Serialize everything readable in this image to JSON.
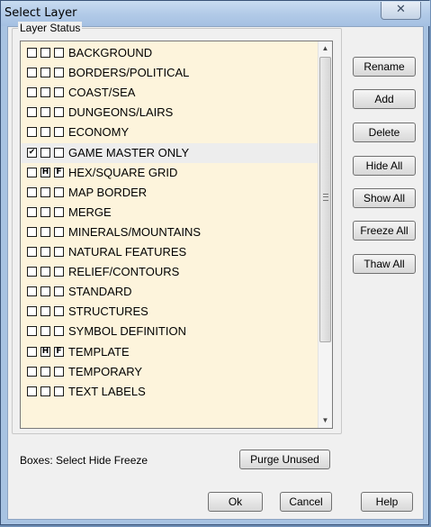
{
  "window": {
    "title": "Select Layer",
    "close_glyph": "✕"
  },
  "group": {
    "legend": "Layer Status"
  },
  "layers": [
    {
      "name": "BACKGROUND",
      "select": false,
      "hide": false,
      "freeze": false
    },
    {
      "name": "BORDERS/POLITICAL",
      "select": false,
      "hide": false,
      "freeze": false
    },
    {
      "name": "COAST/SEA",
      "select": false,
      "hide": false,
      "freeze": false
    },
    {
      "name": "DUNGEONS/LAIRS",
      "select": false,
      "hide": false,
      "freeze": false
    },
    {
      "name": "ECONOMY",
      "select": false,
      "hide": false,
      "freeze": false
    },
    {
      "name": "GAME MASTER ONLY",
      "select": true,
      "hide": false,
      "freeze": false,
      "highlighted": true
    },
    {
      "name": "HEX/SQUARE GRID",
      "select": false,
      "hide": true,
      "freeze": true
    },
    {
      "name": "MAP BORDER",
      "select": false,
      "hide": false,
      "freeze": false
    },
    {
      "name": "MERGE",
      "select": false,
      "hide": false,
      "freeze": false
    },
    {
      "name": "MINERALS/MOUNTAINS",
      "select": false,
      "hide": false,
      "freeze": false
    },
    {
      "name": "NATURAL FEATURES",
      "select": false,
      "hide": false,
      "freeze": false
    },
    {
      "name": "RELIEF/CONTOURS",
      "select": false,
      "hide": false,
      "freeze": false
    },
    {
      "name": "STANDARD",
      "select": false,
      "hide": false,
      "freeze": false
    },
    {
      "name": "STRUCTURES",
      "select": false,
      "hide": false,
      "freeze": false
    },
    {
      "name": "SYMBOL DEFINITION",
      "select": false,
      "hide": false,
      "freeze": false
    },
    {
      "name": "TEMPLATE",
      "select": false,
      "hide": true,
      "freeze": true
    },
    {
      "name": "TEMPORARY",
      "select": false,
      "hide": false,
      "freeze": false
    },
    {
      "name": "TEXT LABELS",
      "select": false,
      "hide": false,
      "freeze": false
    }
  ],
  "marks": {
    "select": "✔",
    "hide": "H",
    "freeze": "F"
  },
  "side_buttons": [
    "Rename",
    "Add",
    "Delete",
    "Hide All",
    "Show All",
    "Freeze All",
    "Thaw All"
  ],
  "footer": {
    "boxes_label": "Boxes: Select Hide Freeze",
    "purge_label": "Purge Unused",
    "ok_label": "Ok",
    "cancel_label": "Cancel",
    "help_label": "Help"
  }
}
